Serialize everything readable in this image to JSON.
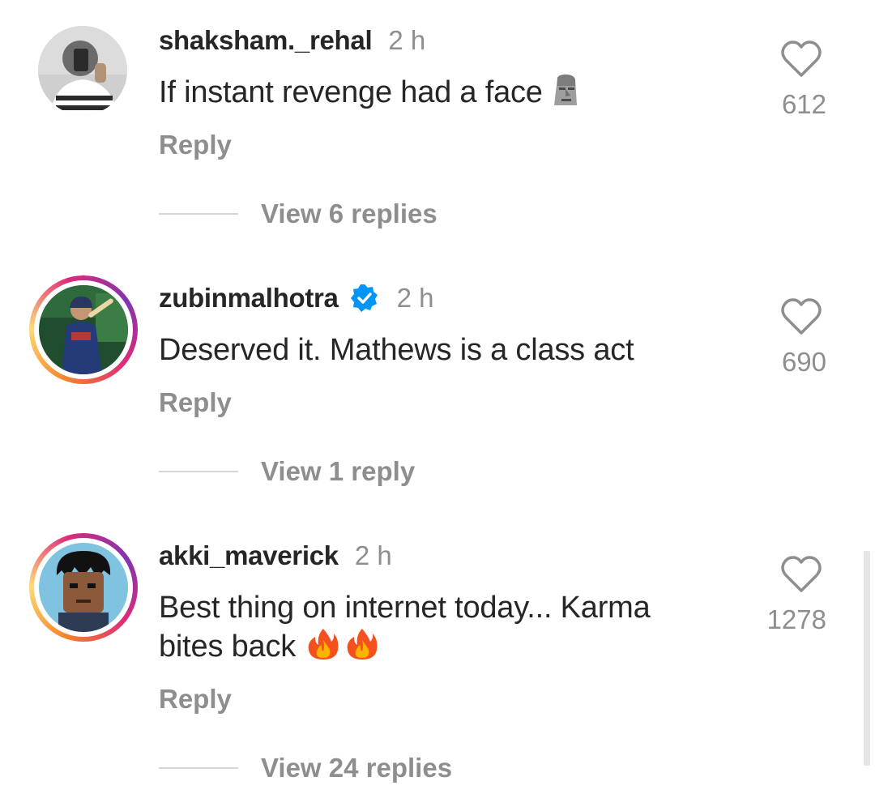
{
  "comments": [
    {
      "username": "shaksham._rehal",
      "time": "2 h",
      "text": "If instant revenge had a face",
      "emoji": "moai-icon",
      "reply_label": "Reply",
      "view_replies": "View 6 replies",
      "likes": "612",
      "verified": false
    },
    {
      "username": "zubinmalhotra",
      "time": "2 h",
      "text": "Deserved it. Mathews is a class act",
      "reply_label": "Reply",
      "view_replies": "View 1 reply",
      "likes": "690",
      "verified": true
    },
    {
      "username": "akki_maverick",
      "time": "2 h",
      "text_line1": "Best thing on internet today... Karma",
      "text_line2": "bites back",
      "emoji": "fire-icon",
      "reply_label": "Reply",
      "view_replies": "View 24 replies",
      "likes": "1278",
      "verified": false
    }
  ],
  "colors": {
    "text": "#262626",
    "secondary": "#8e8e8e",
    "verified": "#0095f6"
  }
}
